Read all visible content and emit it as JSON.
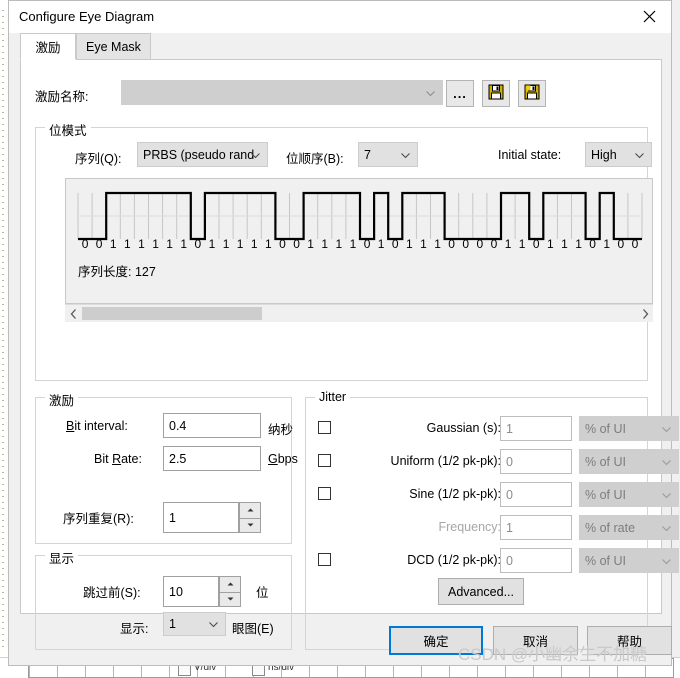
{
  "window": {
    "title": "Configure Eye Diagram",
    "close_icon": "close-icon"
  },
  "tabs": [
    {
      "label": "激励",
      "active": true
    },
    {
      "label": "Eye Mask",
      "active": false
    }
  ],
  "stimulus_name": {
    "label": "激励名称:",
    "value": "",
    "browse_label": "...",
    "save_icon": "floppy-disk-icon",
    "save_as_icon": "floppy-disk-star-icon"
  },
  "bit_pattern": {
    "group_title": "位模式",
    "sequence_label": "序列(Q):",
    "sequence_value": "PRBS (pseudo rand",
    "bit_order_label": "位顺序(B):",
    "bit_order_value": "7",
    "initial_state_label": "Initial state:",
    "initial_state_value": "High",
    "sequence_length_label": "序列长度: 127",
    "bits": "0 0 1 1 1 1 1 1 0 1 1 1 1 1 0 0 1 1 1 1 0 1 0 1 1 1 0 0 0 0 1 1 0 1 1 1 0 1 0 0",
    "bit_array": [
      0,
      0,
      1,
      1,
      1,
      1,
      1,
      1,
      0,
      1,
      1,
      1,
      1,
      1,
      0,
      0,
      1,
      1,
      1,
      1,
      0,
      1,
      0,
      1,
      1,
      1,
      0,
      0,
      0,
      0,
      1,
      1,
      0,
      1,
      1,
      1,
      0,
      1,
      0,
      0
    ]
  },
  "stimulus": {
    "group_title": "激励",
    "bit_interval_label": "Bit interval:",
    "bit_interval_value": "0.4",
    "bit_interval_unit": "纳秒",
    "bit_rate_label": "Bit Rate:",
    "bit_rate_value": "2.5",
    "bit_rate_unit": "Gbps",
    "seq_repeat_label": "序列重复(R):",
    "seq_repeat_value": "1"
  },
  "display": {
    "group_title": "显示",
    "skip_label": "跳过前(S):",
    "skip_value": "10",
    "skip_unit": "位",
    "show_label": "显示:",
    "show_value": "1",
    "show_unit": "眼图(E)"
  },
  "jitter": {
    "group_title": "Jitter",
    "rows": [
      {
        "checkbox": true,
        "label": "Gaussian (s):",
        "value": "1",
        "unit": "% of UI",
        "disabled_label": false
      },
      {
        "checkbox": true,
        "label": "Uniform (1/2 pk-pk):",
        "value": "0",
        "unit": "% of UI",
        "disabled_label": false
      },
      {
        "checkbox": true,
        "label": "Sine (1/2 pk-pk):",
        "value": "0",
        "unit": "% of UI",
        "disabled_label": false
      },
      {
        "checkbox": false,
        "label": "Frequency:",
        "value": "1",
        "unit": "% of rate",
        "disabled_label": true
      },
      {
        "checkbox": true,
        "label": "DCD (1/2 pk-pk):",
        "value": "0",
        "unit": "% of UI",
        "disabled_label": false
      }
    ],
    "advanced_label": "Advanced..."
  },
  "footer": {
    "ok_label": "确定",
    "cancel_label": "取消",
    "help_label": "帮助"
  },
  "watermark": "CSDN @小幽余生不加糖",
  "background_window": {
    "v_div": "V/div",
    "ns_div": "ns/div"
  },
  "colors": {
    "accent": "#0078d7",
    "dialog_bg": "#f0f0f0",
    "page_bg": "#ffffff",
    "disabled_text": "#a6a6a6"
  }
}
